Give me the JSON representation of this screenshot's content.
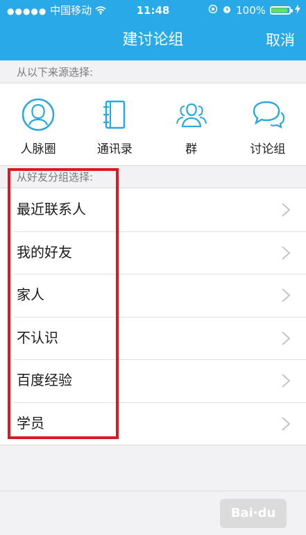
{
  "status_bar": {
    "signal_dots": "●●●●●",
    "carrier": "中国移动",
    "time": "11:48",
    "battery": "100%",
    "battery_level": 1.0
  },
  "nav": {
    "title": "建讨论组",
    "cancel_label": "取消"
  },
  "sources": {
    "section_label": "从以下来源选择:",
    "items": [
      {
        "label": "人脉圈",
        "icon": "person-circle-icon"
      },
      {
        "label": "通讯录",
        "icon": "address-book-icon"
      },
      {
        "label": "群",
        "icon": "group-icon"
      },
      {
        "label": "讨论组",
        "icon": "chat-bubbles-icon"
      }
    ]
  },
  "friend_groups": {
    "section_label": "从好友分组选择:",
    "items": [
      {
        "label": "最近联系人"
      },
      {
        "label": "我的好友"
      },
      {
        "label": "家人"
      },
      {
        "label": "不认识"
      },
      {
        "label": "百度经验"
      },
      {
        "label": "学员"
      }
    ]
  },
  "colors": {
    "nav_bar": "#2aa9e8",
    "icon_accent": "#29a8e0",
    "highlight_box": "#d91a22"
  }
}
